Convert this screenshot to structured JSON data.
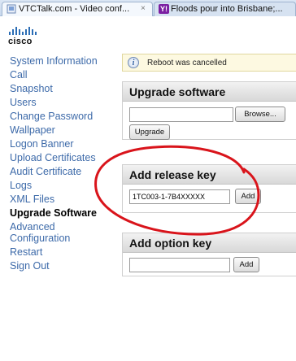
{
  "browser": {
    "tabs": [
      {
        "title": "VTCTalk.com - Video conf...",
        "close": "×"
      },
      {
        "title": "Floods pour into Brisbane;..."
      }
    ]
  },
  "logo": {
    "text": "cisco"
  },
  "sidebar": {
    "items": [
      {
        "label": "System Information"
      },
      {
        "label": "Call"
      },
      {
        "label": "Snapshot"
      },
      {
        "label": "Users"
      },
      {
        "label": "Change Password"
      },
      {
        "label": "Wallpaper"
      },
      {
        "label": "Logon Banner"
      },
      {
        "label": "Upload Certificates"
      },
      {
        "label": "Audit Certificate"
      },
      {
        "label": "Logs"
      },
      {
        "label": "XML Files"
      },
      {
        "label": "Upgrade Software",
        "active": true
      },
      {
        "label": "Advanced Configuration"
      },
      {
        "label": "Restart"
      },
      {
        "label": "Sign Out"
      }
    ]
  },
  "notice": {
    "text": "Reboot was cancelled"
  },
  "upgrade": {
    "title": "Upgrade software",
    "file_value": "",
    "browse_label": "Browse...",
    "upgrade_label": "Upgrade"
  },
  "release_key": {
    "title": "Add release key",
    "value": "1TC003-1-7B4XXXXX",
    "add_label": "Add"
  },
  "option_key": {
    "title": "Add option key",
    "value": "",
    "add_label": "Add"
  },
  "colors": {
    "link": "#3d6aa9",
    "annotation": "#d9141b",
    "notice_bg": "#fdf9e1"
  }
}
